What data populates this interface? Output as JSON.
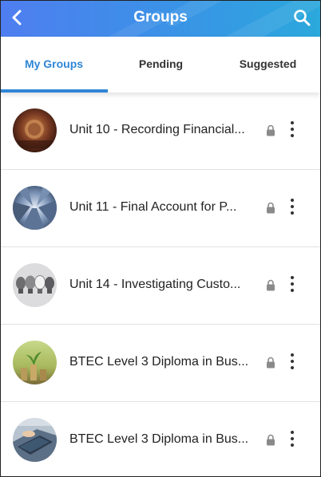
{
  "header": {
    "title": "Groups",
    "back_icon": "chevron-left-icon",
    "search_icon": "search-icon",
    "gradient_colors": [
      "#4f7ef0",
      "#2ba8dc"
    ]
  },
  "tabs": [
    {
      "label": "My Groups",
      "active": true
    },
    {
      "label": "Pending",
      "active": false
    },
    {
      "label": "Suggested",
      "active": false
    }
  ],
  "accent_color": "#2f86d6",
  "groups": [
    {
      "title": "Unit 10 - Recording Financial...",
      "image": "coins-photo",
      "private": true
    },
    {
      "title": "Unit 11 - Final Account for P...",
      "image": "skyscrapers-photo",
      "private": true
    },
    {
      "title": "Unit 14 - Investigating Custo...",
      "image": "lightbulbs-photo",
      "private": true
    },
    {
      "title": "BTEC Level 3 Diploma in Bus...",
      "image": "plant-coins-photo",
      "private": true
    },
    {
      "title": "BTEC Level 3 Diploma in Bus...",
      "image": "laptop-desk-photo",
      "private": true
    }
  ]
}
